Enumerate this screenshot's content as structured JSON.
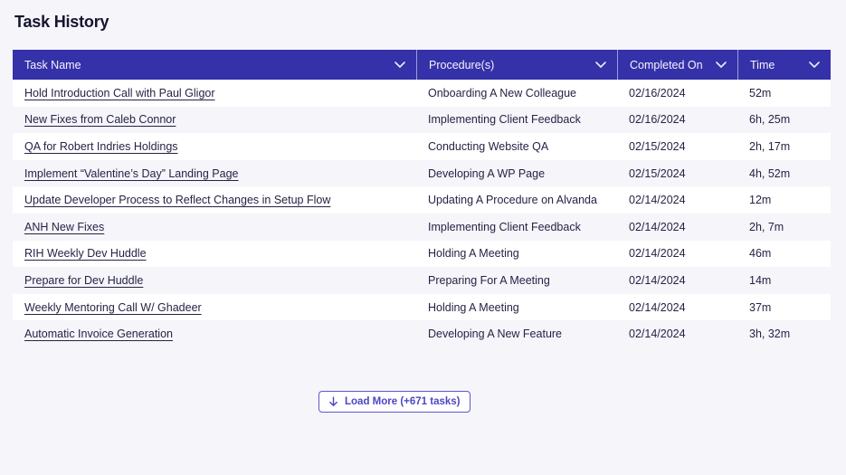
{
  "page": {
    "title": "Task History"
  },
  "colors": {
    "header_bg": "#3531a8",
    "accent": "#4b46c6",
    "page_bg": "#f5f5fa",
    "row_stripe_bg": "#f5f5fa",
    "row_bg": "#ffffff",
    "text": "#262345"
  },
  "table": {
    "columns": [
      {
        "label": "Task Name",
        "sort_icon": "chevron-down-icon"
      },
      {
        "label": "Procedure(s)",
        "sort_icon": "chevron-down-icon"
      },
      {
        "label": "Completed On",
        "sort_icon": "chevron-down-icon"
      },
      {
        "label": "Time",
        "sort_icon": "chevron-down-icon"
      }
    ],
    "rows": [
      {
        "task": "Hold Introduction Call with Paul Gligor",
        "procedure": "Onboarding A New Colleague",
        "completed_on": "02/16/2024",
        "time": "52m"
      },
      {
        "task": "New Fixes from Caleb Connor",
        "procedure": "Implementing Client Feedback",
        "completed_on": "02/16/2024",
        "time": "6h, 25m"
      },
      {
        "task": "QA for Robert Indries Holdings",
        "procedure": "Conducting Website QA",
        "completed_on": "02/15/2024",
        "time": "2h, 17m"
      },
      {
        "task": "Implement “Valentine’s Day” Landing Page",
        "procedure": "Developing A WP Page",
        "completed_on": "02/15/2024",
        "time": "4h, 52m"
      },
      {
        "task": "Update Developer Process to Reflect Changes in Setup Flow",
        "procedure": "Updating A Procedure on Alvanda",
        "completed_on": "02/14/2024",
        "time": "12m"
      },
      {
        "task": "ANH New Fixes",
        "procedure": "Implementing Client Feedback",
        "completed_on": "02/14/2024",
        "time": "2h, 7m"
      },
      {
        "task": "RIH Weekly Dev Huddle",
        "procedure": "Holding A Meeting",
        "completed_on": "02/14/2024",
        "time": "46m"
      },
      {
        "task": "Prepare for Dev Huddle",
        "procedure": "Preparing For A Meeting",
        "completed_on": "02/14/2024",
        "time": "14m"
      },
      {
        "task": "Weekly Mentoring Call W/ Ghadeer",
        "procedure": "Holding A Meeting",
        "completed_on": "02/14/2024",
        "time": "37m"
      },
      {
        "task": "Automatic Invoice Generation",
        "procedure": "Developing A New Feature",
        "completed_on": "02/14/2024",
        "time": "3h, 32m"
      }
    ]
  },
  "load_more": {
    "label": "Load More (+671 tasks)",
    "remaining_tasks": 671,
    "icon": "arrow-down-icon"
  }
}
